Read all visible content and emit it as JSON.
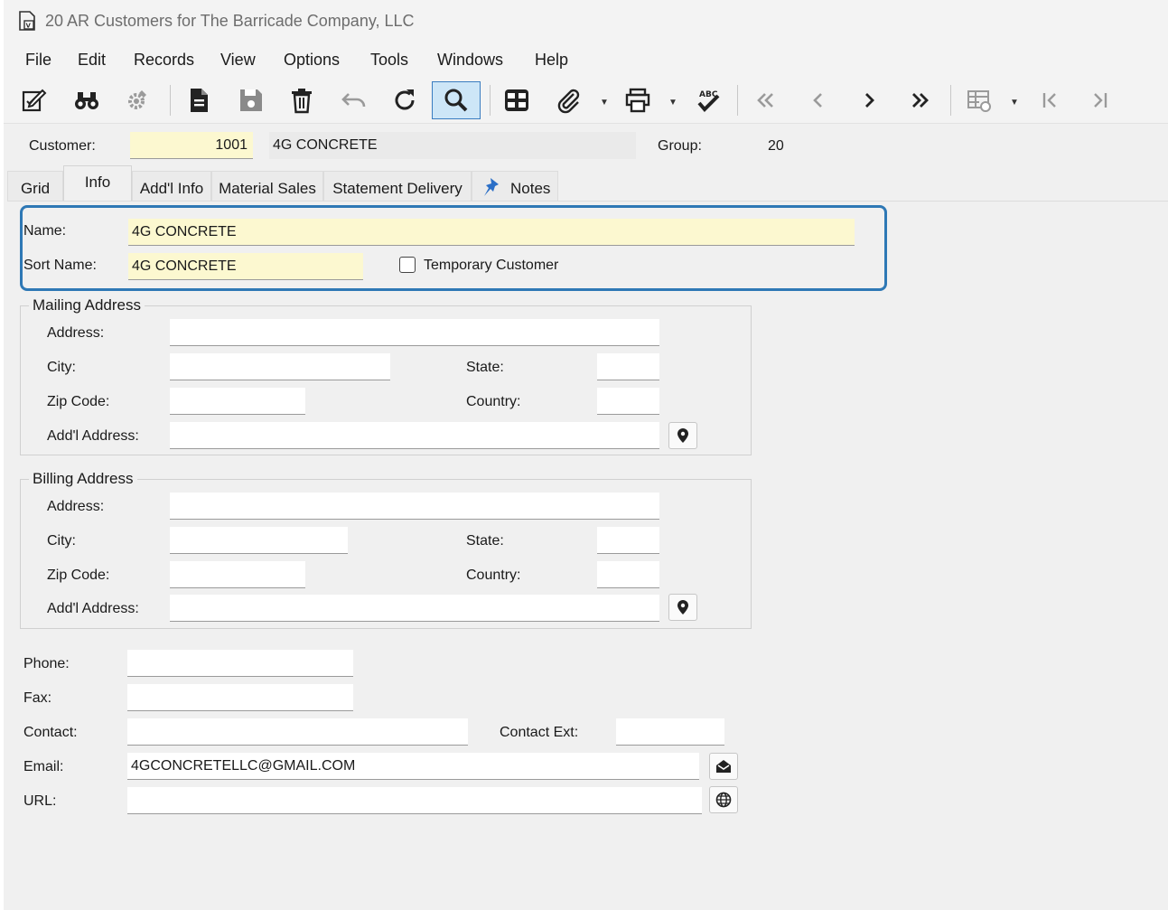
{
  "window": {
    "title": "20 AR Customers for The Barricade Company, LLC"
  },
  "menu": [
    "File",
    "Edit",
    "Records",
    "View",
    "Options",
    "Tools",
    "Windows",
    "Help"
  ],
  "toolbar": {
    "icons": [
      "edit-icon",
      "binoculars-icon",
      "settings-gear-icon",
      "new-document-icon",
      "save-icon",
      "delete-icon",
      "undo-icon",
      "refresh-icon",
      "search-icon",
      "grid-layout-icon",
      "attachment-icon",
      "print-icon",
      "spellcheck-icon",
      "first-record-icon",
      "previous-record-icon",
      "next-record-icon",
      "last-record-icon",
      "table-settings-icon",
      "first-page-icon",
      "last-page-icon"
    ],
    "active": "search-icon"
  },
  "header": {
    "customer_label": "Customer:",
    "customer_number": "1001",
    "customer_name": "4G CONCRETE",
    "group_label": "Group:",
    "group_value": "20"
  },
  "tabs": [
    "Grid",
    "Info",
    "Add'l Info",
    "Material Sales",
    "Statement Delivery",
    "Notes"
  ],
  "active_tab": "Info",
  "info": {
    "name_label": "Name:",
    "name_value": "4G CONCRETE",
    "sort_name_label": "Sort Name:",
    "sort_name_value": "4G CONCRETE",
    "temporary_customer_label": "Temporary Customer",
    "temporary_customer_checked": false
  },
  "mailing": {
    "title": "Mailing Address",
    "address_label": "Address:",
    "address_value": "",
    "city_label": "City:",
    "city_value": "",
    "state_label": "State:",
    "state_value": "",
    "zip_label": "Zip Code:",
    "zip_value": "",
    "country_label": "Country:",
    "country_value": "",
    "addl_label": "Add'l Address:",
    "addl_value": ""
  },
  "billing": {
    "title": "Billing Address",
    "address_label": "Address:",
    "address_value": "",
    "city_label": "City:",
    "city_value": "",
    "state_label": "State:",
    "state_value": "",
    "zip_label": "Zip Code:",
    "zip_value": "",
    "country_label": "Country:",
    "country_value": "",
    "addl_label": "Add'l Address:",
    "addl_value": ""
  },
  "contact": {
    "phone_label": "Phone:",
    "phone_value": "",
    "fax_label": "Fax:",
    "fax_value": "",
    "contact_label": "Contact:",
    "contact_value": "",
    "contact_ext_label": "Contact Ext:",
    "contact_ext_value": "",
    "email_label": "Email:",
    "email_value": "4GCONCRETELLC@GMAIL.COM",
    "url_label": "URL:",
    "url_value": ""
  },
  "colors": {
    "highlight_border": "#2e78b5",
    "required_field": "#fcf8d0",
    "active_tool": "#cde6f7"
  }
}
